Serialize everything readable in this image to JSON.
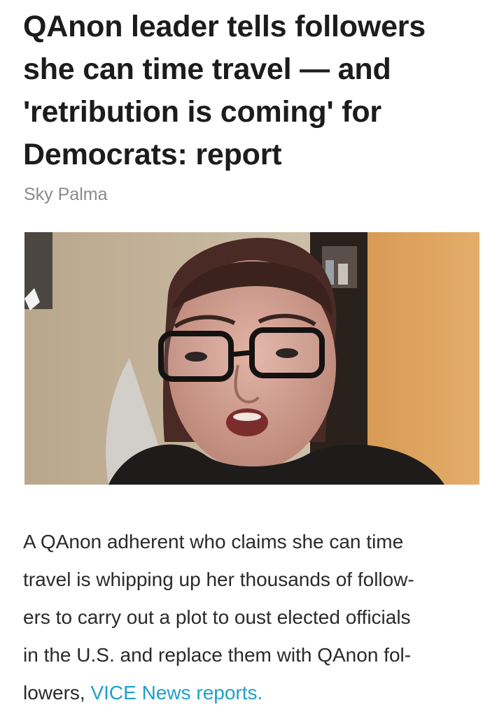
{
  "article": {
    "headline_lines": [
      "QAnon leader tells followers",
      "she can time travel — and",
      "'retribution is coming' for",
      "Democrats: report"
    ],
    "byline": "Sky Palma",
    "body_lines": [
      "A QAnon adherent who claims she can time",
      "travel is whipping up her thousands of follow-",
      "ers to carry out a plot to oust elected officials",
      "in the U.S. and replace them with QAnon fol-"
    ],
    "last_line_prefix": "lowers, ",
    "link_text": "VICE News reports."
  },
  "colors": {
    "link": "#1fa0c9",
    "byline": "#8a8a8a",
    "headline": "#1c1c1c"
  }
}
